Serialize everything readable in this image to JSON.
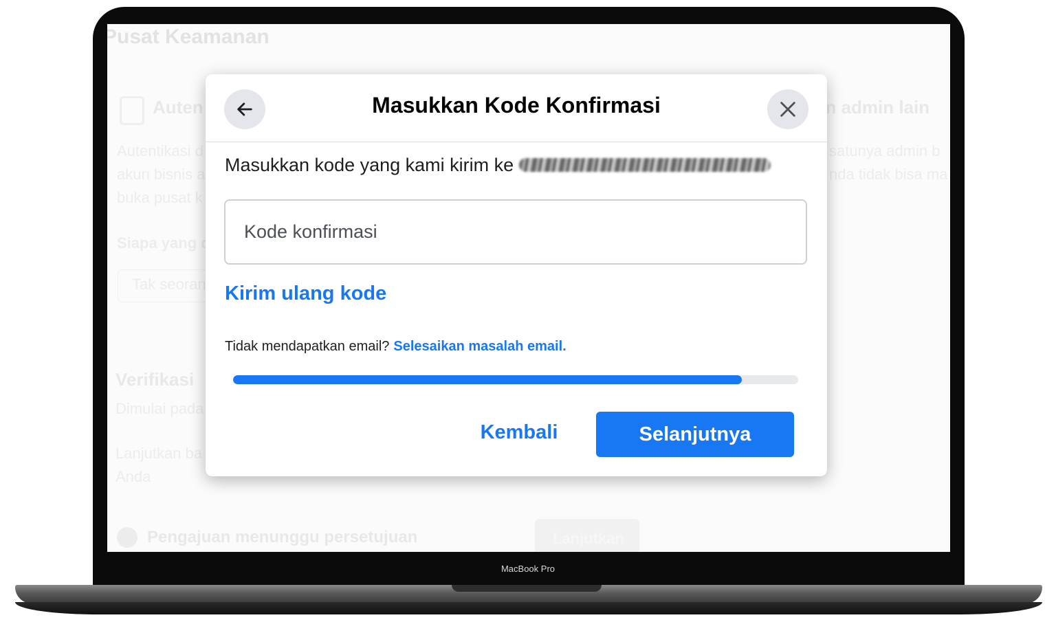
{
  "device": {
    "label": "MacBook Pro"
  },
  "background_page": {
    "title": "Pusat Keamanan",
    "card_left_heading": "Auten",
    "card_left_text_1": "Autentikasi d",
    "card_left_text_2": "akun bisnis a",
    "card_left_text_3": "buka pusat k",
    "card_left_question": "Siapa yang d",
    "card_left_field": "Tak seorang",
    "card_right_heading": "an admin lain",
    "card_right_text_1": "satunya admin b",
    "card_right_text_2": "nda tidak bisa ma",
    "verify_heading": "Verifikasi",
    "verify_text": "Dimulai pada",
    "continue_text_1": "Lanjutkan ba",
    "continue_text_2": "Anda",
    "pending_text": "Pengajuan menunggu persetujuan",
    "pending_button": "Lanjutkan"
  },
  "modal": {
    "title": "Masukkan Kode Konfirmasi",
    "description": "Masukkan kode yang kami kirim ke",
    "code_input": {
      "placeholder": "Kode konfirmasi",
      "value": ""
    },
    "resend_link": "Kirim ulang kode",
    "help_text": "Tidak mendapatkan email?",
    "help_link": "Selesaikan masalah email.",
    "progress_fraction": 0.9,
    "back_button": "Kembali",
    "next_button": "Selanjutnya",
    "icons": {
      "back": "arrow-left-icon",
      "close": "close-icon"
    },
    "colors": {
      "accent": "#1877f2",
      "icon_bg": "#e4e6eb"
    }
  }
}
